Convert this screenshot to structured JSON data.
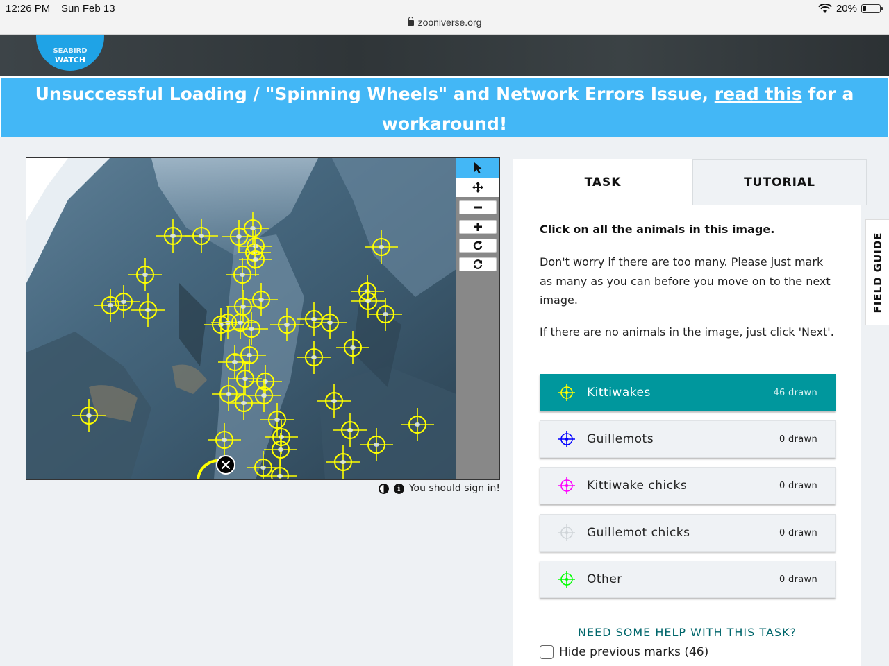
{
  "status_bar": {
    "time": "12:26 PM",
    "date": "Sun Feb 13",
    "url": "zooniverse.org",
    "battery": "20%"
  },
  "logo": {
    "text": "WATCH",
    "text_partial": "SEABIRD"
  },
  "banner": {
    "text_before": "Unsuccessful Loading / \"Spinning Wheels\" and Network Errors Issue, ",
    "link": "read this",
    "text_after": " for a workaround!"
  },
  "viewer": {
    "toolbar": [
      "pointer-icon",
      "move-icon",
      "zoom-out-icon",
      "zoom-in-icon",
      "rotate-icon",
      "reset-icon"
    ],
    "sign_in_note": "You should sign in!",
    "mark_color": "#ffff00",
    "marks_count": 46
  },
  "tabs": {
    "task": "TASK",
    "tutorial": "TUTORIAL"
  },
  "task": {
    "question": "Click on all the animals in this image.",
    "paragraph1": "Don't worry if there are too many. Please just mark as many as you can before you move on to the next image.",
    "paragraph2": "If there are no animals in the image, just click 'Next'.",
    "choices": [
      {
        "label": "Kittiwakes",
        "count": "46 drawn",
        "color": "#ffff00",
        "selected": true
      },
      {
        "label": "Guillemots",
        "count": "0 drawn",
        "color": "#0000ff",
        "selected": false
      },
      {
        "label": "Kittiwake chicks",
        "count": "0 drawn",
        "color": "#ff00ff",
        "selected": false
      },
      {
        "label": "Guillemot chicks",
        "count": "0 drawn",
        "color": "#ffffff",
        "selected": false
      },
      {
        "label": "Other",
        "count": "0 drawn",
        "color": "#00ff00",
        "selected": false
      }
    ],
    "help": "NEED SOME HELP WITH THIS TASK?",
    "hide_marks": "Hide previous marks (46)"
  },
  "field_guide": "FIELD GUIDE"
}
